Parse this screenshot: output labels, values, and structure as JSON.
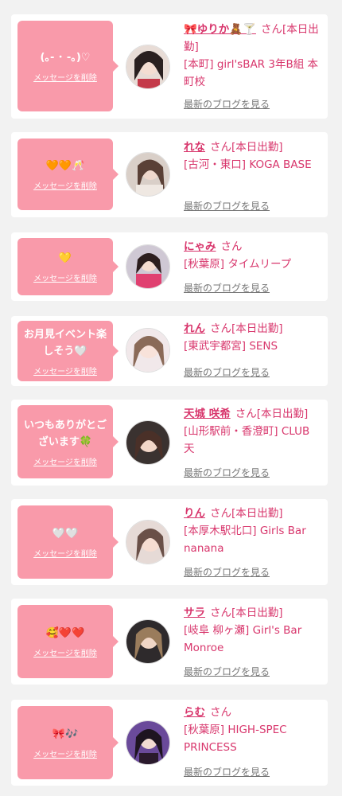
{
  "common": {
    "delete_label": "メッセージを削除",
    "blog_label": "最新のブログを見る",
    "san": "さん"
  },
  "colors": {
    "bubble": "#f99aaa",
    "accent": "#d8366c",
    "background": "#f2f2f2"
  },
  "cards": [
    {
      "message": "(｡- ･ -｡)♡",
      "name": "🎀ゆりか🧸🍸",
      "status": "[本日出勤]",
      "shop": "[本町] girl'sBAR 3年B組 本町校",
      "avatar_icon": "girl-photo-1"
    },
    {
      "message": "🧡🧡🥂",
      "name": "れな",
      "status": "[本日出勤]",
      "shop": "[古河・東口] KOGA BASE",
      "avatar_icon": "girl-photo-2"
    },
    {
      "message": "💛",
      "name": "にゃみ",
      "status": "",
      "shop": "[秋葉原] タイムリープ",
      "avatar_icon": "girl-photo-3"
    },
    {
      "message": "お月見イベント楽しそう🤍",
      "name": "れん",
      "status": "[本日出勤]",
      "shop": "[東武宇都宮] SENS",
      "avatar_icon": "girl-photo-4"
    },
    {
      "message": "いつもありがとございます🍀",
      "name": "天城 咲希",
      "status": "[本日出勤]",
      "shop": "[山形駅前・香澄町] CLUB 天",
      "avatar_icon": "girl-photo-5"
    },
    {
      "message": "🤍🤍",
      "name": "りん",
      "status": "[本日出勤]",
      "shop": "[本厚木駅北口] Girls Bar nanana",
      "avatar_icon": "girl-photo-6"
    },
    {
      "message": "🥰❤️❤️",
      "name": "サラ",
      "status": "[本日出勤]",
      "shop": "[岐阜 柳ヶ瀬] Girl's Bar Monroe",
      "avatar_icon": "girl-photo-7"
    },
    {
      "message": "🎀🎶",
      "name": "らむ",
      "status": "",
      "shop": "[秋葉原] HIGH-SPEC PRINCESS",
      "avatar_icon": "girl-photo-8"
    }
  ]
}
